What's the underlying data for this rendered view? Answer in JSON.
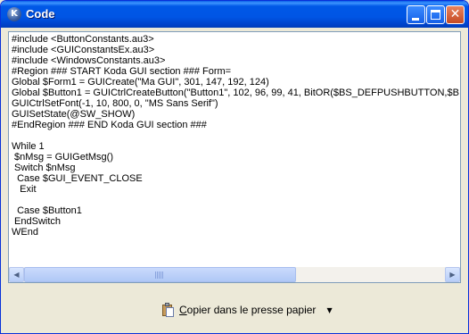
{
  "window": {
    "title": "Code",
    "app_icon_letter": "K"
  },
  "titlebar_buttons": {
    "close_glyph": "✕"
  },
  "editor": {
    "code": "#include <ButtonConstants.au3>\n#include <GUIConstantsEx.au3>\n#include <WindowsConstants.au3>\n#Region ### START Koda GUI section ### Form=\nGlobal $Form1 = GUICreate(\"Ma GUI\", 301, 147, 192, 124)\nGlobal $Button1 = GUICtrlCreateButton(\"Button1\", 102, 96, 99, 41, BitOR($BS_DEFPUSHBUTTON,$BS_\\\nGUICtrlSetFont(-1, 10, 800, 0, \"MS Sans Serif\")\nGUISetState(@SW_SHOW)\n#EndRegion ### END Koda GUI section ###\n\nWhile 1\n $nMsg = GUIGetMsg()\n Switch $nMsg\n  Case $GUI_EVENT_CLOSE\n   Exit\n\n  Case $Button1\n EndSwitch\nWEnd",
    "scroll_left_glyph": "◀",
    "scroll_right_glyph": "▶"
  },
  "footer": {
    "copy_button_first_letter": "C",
    "copy_button_rest": "opier dans le presse papier",
    "dropdown_glyph": "▼"
  }
}
